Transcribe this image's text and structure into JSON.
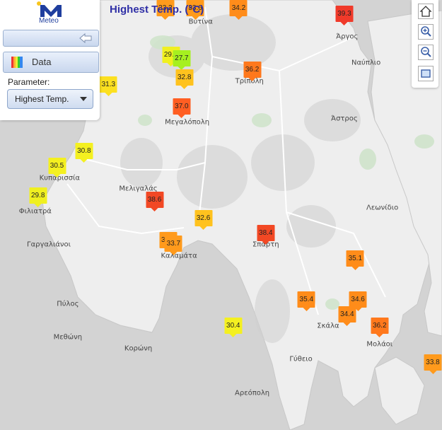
{
  "title": "Highest Temp. (°C)",
  "logo": {
    "text": "Meteo"
  },
  "panel": {
    "data_label": "Data",
    "parameter_label": "Parameter:",
    "parameter_value": "Highest Temp."
  },
  "toolbar": [
    "home-icon",
    "zoom-in-icon",
    "zoom-out-icon",
    "fit-extent-icon"
  ],
  "colors": {
    "title": "#2f2fa6",
    "land": "#eeeeee",
    "sea": "#d3d3d3"
  },
  "towns": [
    {
      "name": "Βυτίνα",
      "lon": 22.19,
      "lat": 37.67
    },
    {
      "name": "Άργος",
      "lon": 22.73,
      "lat": 37.63
    },
    {
      "name": "Ναύπλιο",
      "lon": 22.8,
      "lat": 37.56
    },
    {
      "name": "Τρίπολη",
      "lon": 22.37,
      "lat": 37.51
    },
    {
      "name": "Μεγαλόπολη",
      "lon": 22.14,
      "lat": 37.4
    },
    {
      "name": "Άστρος",
      "lon": 22.72,
      "lat": 37.41
    },
    {
      "name": "Κυπαρισσία",
      "lon": 21.67,
      "lat": 37.25
    },
    {
      "name": "Μελιγαλάς",
      "lon": 21.96,
      "lat": 37.22
    },
    {
      "name": "Φιλιατρά",
      "lon": 21.58,
      "lat": 37.16
    },
    {
      "name": "Λεωνίδιο",
      "lon": 22.86,
      "lat": 37.17
    },
    {
      "name": "Γαργαλιάνοι",
      "lon": 21.63,
      "lat": 37.07
    },
    {
      "name": "Καλαμάτα",
      "lon": 22.11,
      "lat": 37.04
    },
    {
      "name": "Σπάρτη",
      "lon": 22.43,
      "lat": 37.07
    },
    {
      "name": "Πύλος",
      "lon": 21.7,
      "lat": 36.91
    },
    {
      "name": "Σκάλα",
      "lon": 22.66,
      "lat": 36.85
    },
    {
      "name": "Μεθώνη",
      "lon": 21.7,
      "lat": 36.82
    },
    {
      "name": "Μολάοι",
      "lon": 22.85,
      "lat": 36.8
    },
    {
      "name": "Κορώνη",
      "lon": 21.96,
      "lat": 36.79
    },
    {
      "name": "Γύθειο",
      "lon": 22.56,
      "lat": 36.76
    },
    {
      "name": "Αρεόπολη",
      "lon": 22.38,
      "lat": 36.67
    }
  ],
  "stations": [
    {
      "value": 33.2,
      "lon": 22.06,
      "lat": 37.71,
      "color": "#ff9a1c"
    },
    {
      "value": 33.6,
      "lon": 22.17,
      "lat": 37.71,
      "color": "#ff9a1c"
    },
    {
      "value": 34.2,
      "lon": 22.33,
      "lat": 37.71,
      "color": "#ff8c1a"
    },
    {
      "value": 39.3,
      "lon": 22.72,
      "lat": 37.67,
      "color": "#f03a2a"
    },
    {
      "value": 29.6,
      "lon": 22.08,
      "lat": 37.56,
      "color": "#f0f020"
    },
    {
      "value": 27.7,
      "lon": 22.12,
      "lat": 37.55,
      "color": "#a6f020"
    },
    {
      "value": 32.8,
      "lon": 22.13,
      "lat": 37.5,
      "color": "#ffc21e"
    },
    {
      "value": 36.2,
      "lon": 22.38,
      "lat": 37.52,
      "color": "#ff781c"
    },
    {
      "value": 31.3,
      "lon": 21.85,
      "lat": 37.48,
      "color": "#fce020"
    },
    {
      "value": 37.0,
      "lon": 22.12,
      "lat": 37.42,
      "color": "#ff5e22"
    },
    {
      "value": 30.8,
      "lon": 21.76,
      "lat": 37.3,
      "color": "#f4f020"
    },
    {
      "value": 30.5,
      "lon": 21.66,
      "lat": 37.26,
      "color": "#f4f020"
    },
    {
      "value": 29.8,
      "lon": 21.59,
      "lat": 37.18,
      "color": "#f0f020"
    },
    {
      "value": 38.6,
      "lon": 22.02,
      "lat": 37.17,
      "color": "#f24824"
    },
    {
      "value": 32.6,
      "lon": 22.2,
      "lat": 37.12,
      "color": "#ffc21e"
    },
    {
      "value": 33.7,
      "lon": 22.07,
      "lat": 37.06,
      "color": "#ff9a1c"
    },
    {
      "value": 33.7,
      "lon": 22.09,
      "lat": 37.05,
      "color": "#ff9a1c"
    },
    {
      "value": 38.4,
      "lon": 22.43,
      "lat": 37.08,
      "color": "#f24824"
    },
    {
      "value": 35.1,
      "lon": 22.76,
      "lat": 37.01,
      "color": "#ff8c1a"
    },
    {
      "value": 35.4,
      "lon": 22.58,
      "lat": 36.9,
      "color": "#ff8c1a"
    },
    {
      "value": 34.6,
      "lon": 22.77,
      "lat": 36.9,
      "color": "#ff8c1a"
    },
    {
      "value": 34.4,
      "lon": 22.73,
      "lat": 36.86,
      "color": "#ff8c1a"
    },
    {
      "value": 30.4,
      "lon": 22.31,
      "lat": 36.83,
      "color": "#f4f020"
    },
    {
      "value": 36.2,
      "lon": 22.85,
      "lat": 36.83,
      "color": "#ff781c"
    },
    {
      "value": 33.8,
      "lon": 23.05,
      "lat": 36.73,
      "color": "#ff9a1c"
    }
  ]
}
